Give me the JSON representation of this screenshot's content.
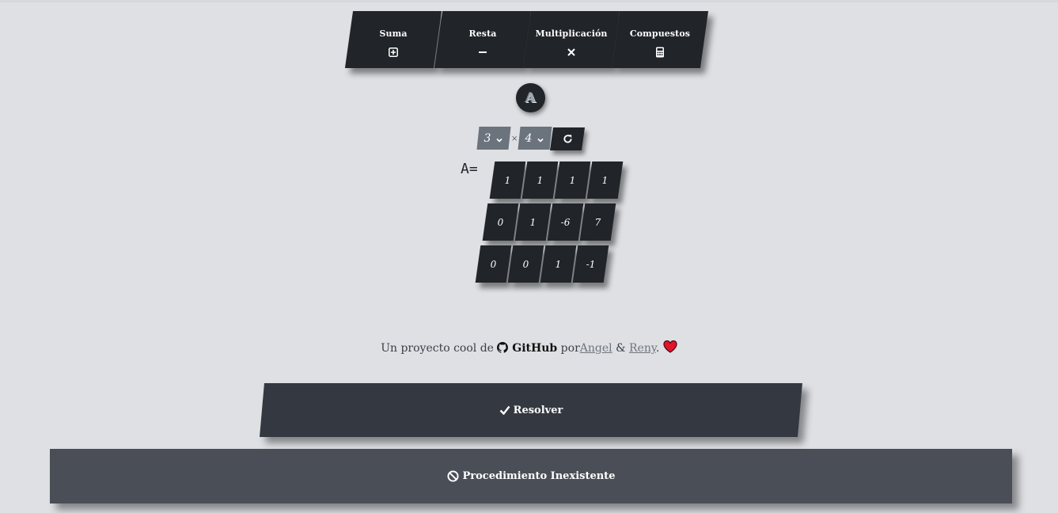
{
  "nav": {
    "items": [
      {
        "label": "Suma",
        "icon": "plus-square-icon"
      },
      {
        "label": "Resta",
        "icon": "minus-icon"
      },
      {
        "label": "Multiplicación",
        "icon": "times-icon"
      },
      {
        "label": "Compuestos",
        "icon": "calculator-icon"
      }
    ]
  },
  "badge": {
    "letter": "A"
  },
  "dimensions": {
    "rows": "3",
    "cols": "4",
    "times": "×"
  },
  "matrix": {
    "label": "A=",
    "rows": [
      [
        "1",
        "1",
        "1",
        "1"
      ],
      [
        "0",
        "1",
        "-6",
        "7"
      ],
      [
        "0",
        "0",
        "1",
        "-1"
      ]
    ]
  },
  "credit": {
    "prefix": "Un proyecto cool de",
    "github": "GitHub",
    "by": "por",
    "author1": "Angel",
    "amp": "&",
    "author2": "Reny",
    "suffix": "."
  },
  "actions": {
    "resolve": "Resolver",
    "procedure": "Procedimiento Inexistente"
  },
  "colors": {
    "background": "#dee0e4",
    "tile": "#212428",
    "selector": "#6b737c",
    "heart": "#e0142a"
  }
}
